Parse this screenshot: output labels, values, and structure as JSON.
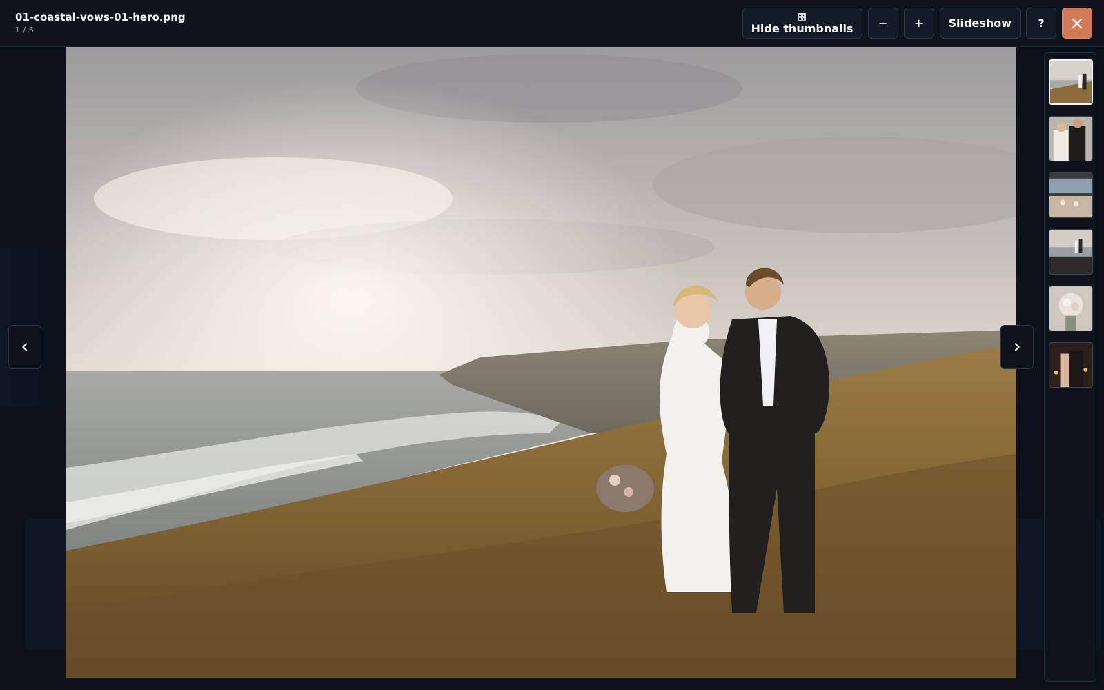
{
  "header": {
    "file_name": "01-coastal-vows-01-hero.png",
    "counter": "1 / 6"
  },
  "toolbar": {
    "hide_thumbnails": {
      "label": "Hide thumbnails",
      "icon": "grid-icon",
      "glyph": "▦"
    },
    "zoom_out": {
      "label": "−",
      "icon": "minus-icon"
    },
    "zoom_in": {
      "label": "+",
      "icon": "plus-icon"
    },
    "slideshow": {
      "label": "Slideshow"
    },
    "help": {
      "label": "?",
      "icon": "help-icon"
    },
    "close": {
      "icon": "close-icon",
      "color": "#d07a58"
    }
  },
  "navigation": {
    "prev_icon": "chevron-left-icon",
    "next_icon": "chevron-right-icon"
  },
  "viewer": {
    "photo_subject": "bride and groom walking on coastal grass cliff",
    "accent": "#d07a58"
  },
  "thumbnails": {
    "active_index": 0,
    "items": [
      {
        "subject": "couple on coastal cliff"
      },
      {
        "subject": "couple portrait"
      },
      {
        "subject": "reception table"
      },
      {
        "subject": "ceremony by the sea"
      },
      {
        "subject": "bridal bouquet"
      },
      {
        "subject": "first dance"
      }
    ]
  }
}
